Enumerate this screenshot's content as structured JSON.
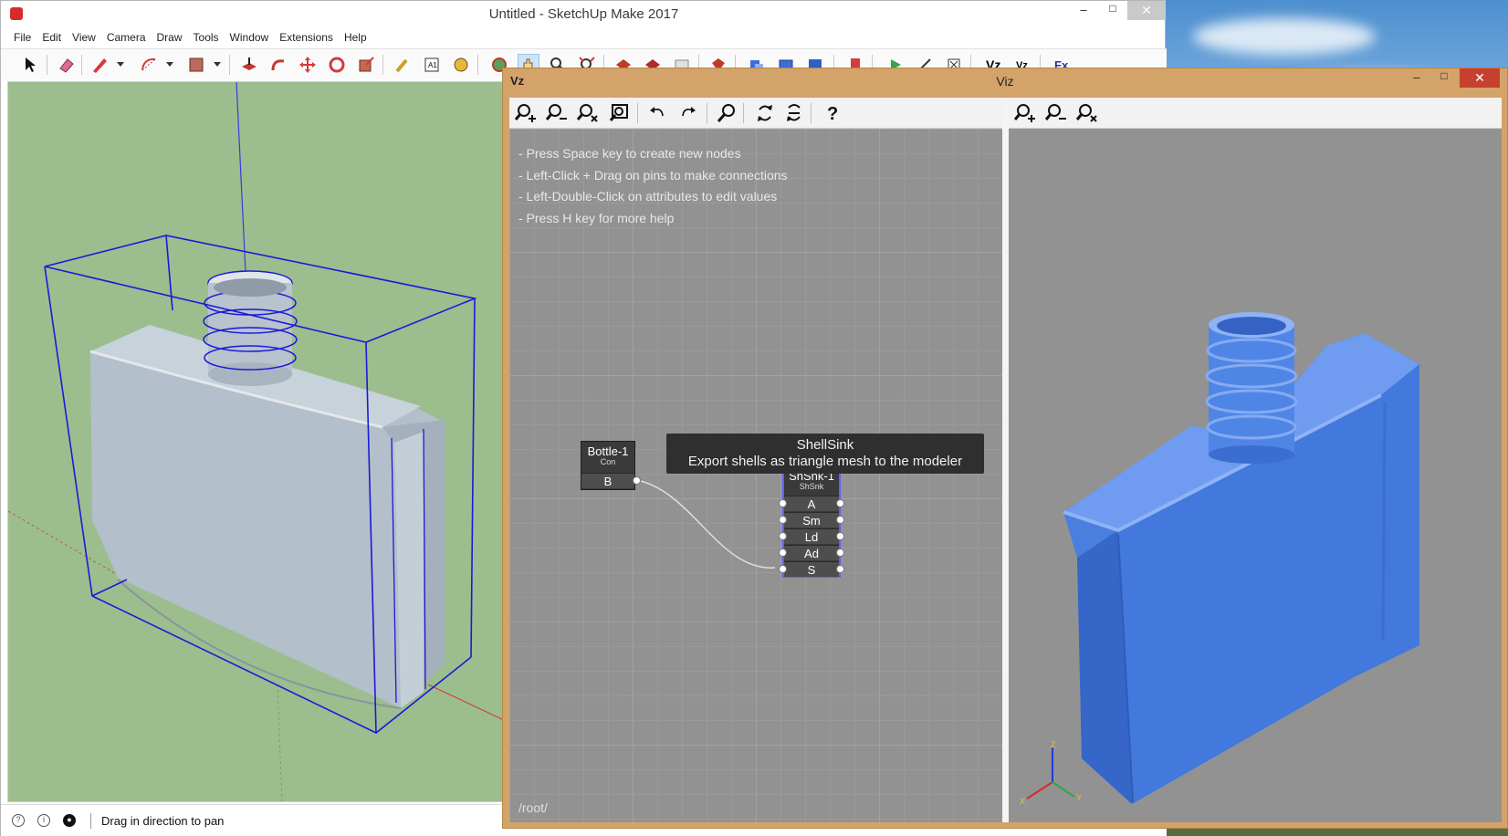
{
  "sketchup": {
    "title": "Untitled - SketchUp Make 2017",
    "menus": [
      "File",
      "Edit",
      "View",
      "Camera",
      "Draw",
      "Tools",
      "Window",
      "Extensions",
      "Help"
    ],
    "status_text": "Drag in direction to pan",
    "window_controls": {
      "minimize": "–",
      "maximize": "□",
      "close": "✕"
    }
  },
  "viz": {
    "title": "Viz",
    "icon_text": "Vz",
    "window_controls": {
      "minimize": "–",
      "maximize": "□",
      "close": "✕"
    },
    "help_lines": [
      "- Press Space key to create new nodes",
      "- Left-Click + Drag on pins to make connections",
      "- Left-Double-Click on attributes to edit values",
      "- Press H key for more help"
    ],
    "path": "/root/",
    "tooltip": {
      "title": "ShellSink",
      "text": "Export shells as triangle mesh to the modeler"
    },
    "nodes": [
      {
        "name": "Bottle-1",
        "type": "Con",
        "pins": [
          "B"
        ]
      },
      {
        "name": "ShSnk-1",
        "type": "ShSnk",
        "pins": [
          "A",
          "Sm",
          "Ld",
          "Ad",
          "S"
        ]
      }
    ],
    "axes": {
      "x": "X",
      "y": "Y",
      "z": "Z"
    }
  },
  "colors": {
    "viewport_bg": "#9cbd8e",
    "bounding_box": "#1a1ad8",
    "bottle_grey": "#b5c1cb",
    "bottle_blue": "#4a7fe0",
    "viz_frame": "#d4a36a",
    "graph_bg": "#929292",
    "node_bg": "#3a3a3a",
    "node_selected": "#5a62ff"
  }
}
